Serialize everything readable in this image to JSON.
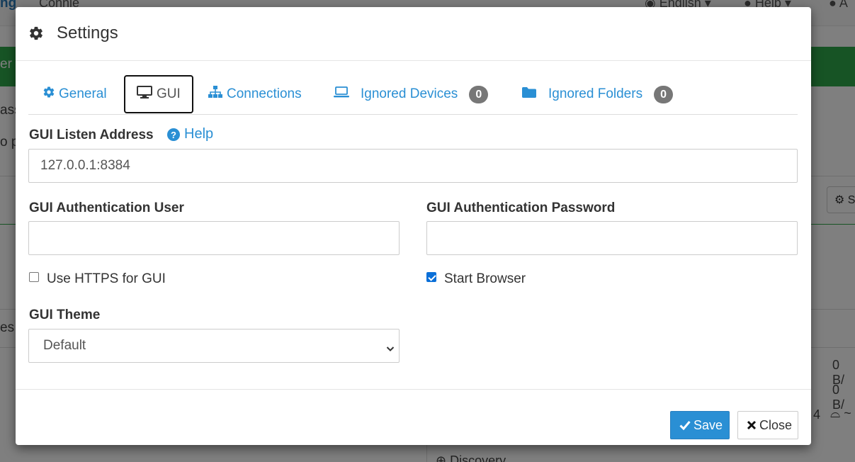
{
  "background": {
    "brand": "ng",
    "device_name": "Connie",
    "language": "English",
    "help": "Help",
    "right_edge_letter": "A",
    "green_bar_text": "er",
    "fragment_1": "ass",
    "fragment_2": "o p",
    "fragment_3": "es",
    "button_fragment": "S",
    "rate_1": "0 B/",
    "rate_2": "0 B/",
    "fragment_4": "4",
    "discovery": "Discovery"
  },
  "modal": {
    "title": "Settings",
    "tabs": [
      {
        "label": "General",
        "icon": "gear-icon"
      },
      {
        "label": "GUI",
        "icon": "monitor-icon",
        "active": true
      },
      {
        "label": "Connections",
        "icon": "sitemap-icon"
      },
      {
        "label": "Ignored Devices",
        "icon": "laptop-icon",
        "badge": "0"
      },
      {
        "label": "Ignored Folders",
        "icon": "folder-icon",
        "badge": "0"
      }
    ],
    "listen_address": {
      "label": "GUI Listen Address",
      "help": "Help",
      "value": "127.0.0.1:8384"
    },
    "auth_user": {
      "label": "GUI Authentication User",
      "value": ""
    },
    "auth_password": {
      "label": "GUI Authentication Password",
      "value": ""
    },
    "use_https": {
      "label": "Use HTTPS for GUI",
      "checked": false
    },
    "start_browser": {
      "label": "Start Browser",
      "checked": true
    },
    "theme": {
      "label": "GUI Theme",
      "selected": "Default"
    },
    "buttons": {
      "save": "Save",
      "close": "Close"
    }
  },
  "colors": {
    "link": "#2a8fd4",
    "save": "#2a8fd4",
    "green_bar": "#2ea84b",
    "badge": "#777777"
  }
}
